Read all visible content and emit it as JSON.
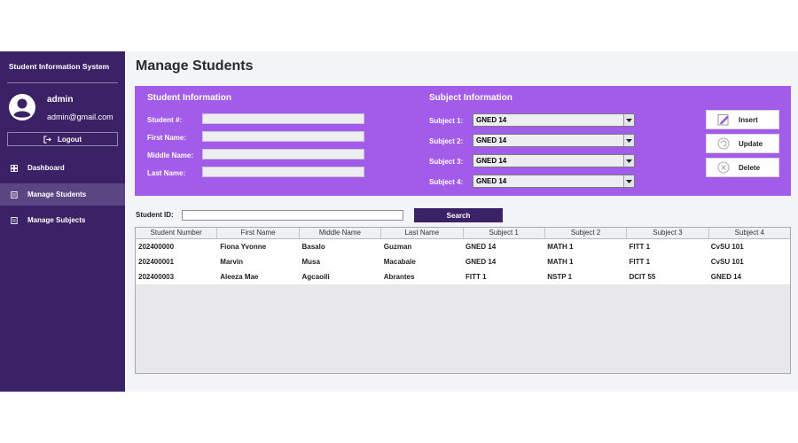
{
  "sidebar": {
    "title": "Student Information System",
    "user": {
      "name": "admin",
      "email": "admin@gmail.com"
    },
    "logout_label": "Logout",
    "nav": [
      {
        "label": "Dashboard",
        "icon": "grid-icon",
        "active": false
      },
      {
        "label": "Manage Students",
        "icon": "document-icon",
        "active": true
      },
      {
        "label": "Manage Subjects",
        "icon": "document-icon",
        "active": false
      }
    ]
  },
  "main": {
    "title": "Manage Students",
    "student_info": {
      "title": "Student Information",
      "fields": [
        {
          "label": "Student #:",
          "value": ""
        },
        {
          "label": "First Name:",
          "value": ""
        },
        {
          "label": "Middle Name:",
          "value": ""
        },
        {
          "label": "Last Name:",
          "value": ""
        }
      ]
    },
    "subject_info": {
      "title": "Subject Information",
      "subjects": [
        {
          "label": "Subject 1:",
          "value": "GNED 14"
        },
        {
          "label": "Subject 2:",
          "value": "GNED 14"
        },
        {
          "label": "Subject 3:",
          "value": "GNED 14"
        },
        {
          "label": "Subject 4:",
          "value": "GNED 14"
        }
      ]
    },
    "actions": {
      "insert": "Insert",
      "update": "Update",
      "delete": "Delete"
    },
    "search": {
      "label": "Student ID:",
      "value": "",
      "button": "Search"
    },
    "table": {
      "columns": [
        "Student Number",
        "First Name",
        "Middle Name",
        "Last Name",
        "Subject 1",
        "Subject 2",
        "Subject 3",
        "Subject 4"
      ],
      "rows": [
        [
          "202400000",
          "Fiona Yvonne",
          "Basalo",
          "Guzman",
          "GNED 14",
          "MATH 1",
          "FITT 1",
          "CvSU 101"
        ],
        [
          "202400001",
          "Marvin",
          "Musa",
          "Macabale",
          "GNED 14",
          "MATH 1",
          "FITT 1",
          "CvSU 101"
        ],
        [
          "202400003",
          "Aleeza Mae",
          "Agcaoili",
          "Abrantes",
          "FITT 1",
          "NSTP 1",
          "DCIT 55",
          "GNED 14"
        ]
      ]
    }
  },
  "colors": {
    "sidebar_bg": "#3b2165",
    "sidebar_active": "#5a4683",
    "panel_purple": "#a35ce9",
    "content_bg": "#f3f4f8"
  }
}
